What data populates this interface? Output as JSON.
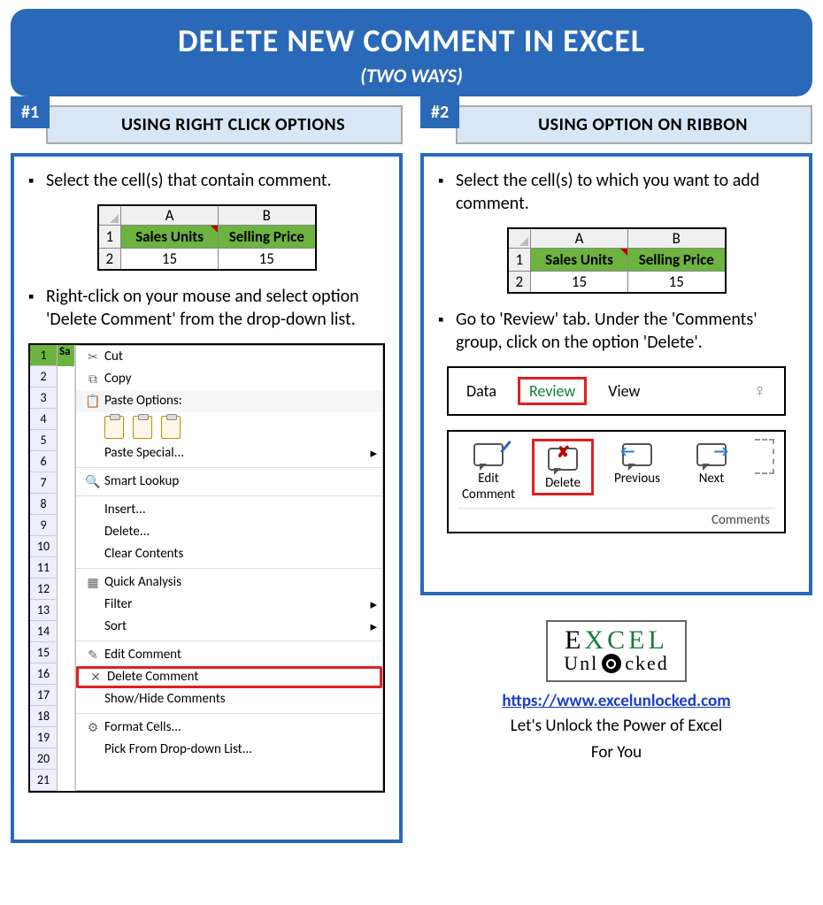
{
  "header": {
    "title": "DELETE NEW COMMENT IN EXCEL",
    "subtitle": "(TWO WAYS)"
  },
  "sections": [
    {
      "badge": "#1",
      "heading": "USING RIGHT CLICK OPTIONS"
    },
    {
      "badge": "#2",
      "heading": "USING OPTION ON RIBBON"
    }
  ],
  "left": {
    "step1": "Select the cell(s) that contain comment.",
    "step2": "Right-click on your mouse and select option 'Delete Comment' from the drop-down list.",
    "table": {
      "colA": "A",
      "colB": "B",
      "r1": "1",
      "r2": "2",
      "h1": "Sales Units",
      "h2": "Selling Price",
      "v1": "15",
      "v2": "15"
    },
    "ctx_sheet_first": "Sa",
    "ctx_rows": [
      "1",
      "2",
      "3",
      "4",
      "5",
      "6",
      "7",
      "8",
      "9",
      "10",
      "11",
      "12",
      "13",
      "14",
      "15",
      "16",
      "17",
      "18",
      "19",
      "20",
      "21"
    ],
    "menu": {
      "cut": "Cut",
      "copy": "Copy",
      "paste_opts": "Paste Options:",
      "paste_special": "Paste Special...",
      "smart": "Smart Lookup",
      "insert": "Insert...",
      "delete": "Delete...",
      "clear": "Clear Contents",
      "quick": "Quick Analysis",
      "filter": "Filter",
      "sort": "Sort",
      "edit_c": "Edit Comment",
      "del_c": "Delete Comment",
      "showhide": "Show/Hide Comments",
      "format": "Format Cells...",
      "pick": "Pick From Drop-down List..."
    }
  },
  "right": {
    "step1": "Select the cell(s) to which you want to add comment.",
    "step2": "Go to 'Review' tab. Under the 'Comments' group, click on the option 'Delete'.",
    "tabs": {
      "data": "Data",
      "review": "Review",
      "view": "View"
    },
    "ribbon": {
      "edit": "Edit Comment",
      "delete": "Delete",
      "prev": "Previous",
      "next": "Next",
      "group": "Comments"
    }
  },
  "footer": {
    "logo_top_1": "E",
    "logo_top_2": "XCEL",
    "logo_bot_pre": "Unl",
    "logo_bot_post": "cked",
    "url": "https://www.excelunlocked.com",
    "tag1": "Let's Unlock the Power of Excel",
    "tag2": "For You"
  }
}
